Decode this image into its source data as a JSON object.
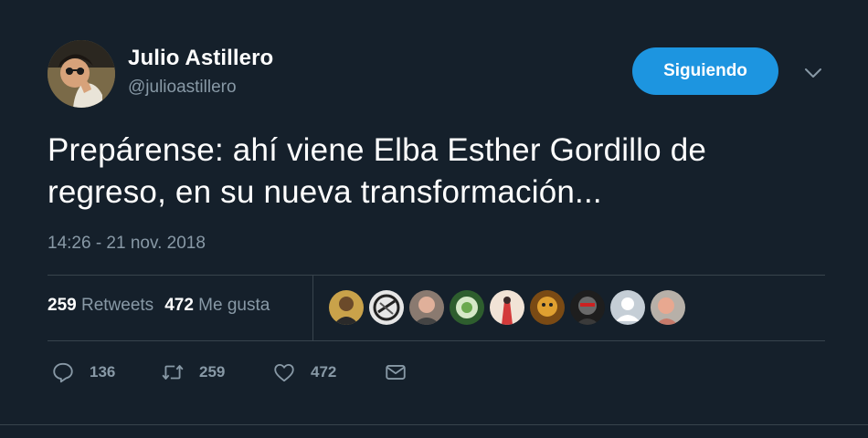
{
  "colors": {
    "background": "#15202b",
    "accent": "#1d95e0",
    "secondary_text": "#8899a6",
    "divider": "#38444d"
  },
  "author": {
    "display_name": "Julio Astillero",
    "handle": "@julioastillero",
    "follow_button_label": "Siguiendo"
  },
  "tweet": {
    "text_line1": "Prepárense: ahí viene Elba Esther Gordillo de",
    "text_line2": "regreso, en su nueva transformación...",
    "timestamp": "14:26 - 21 nov. 2018"
  },
  "stats": {
    "retweets_count": "259",
    "retweets_label": "Retweets",
    "likes_count": "472",
    "likes_label": "Me gusta"
  },
  "likers": [
    {
      "icon": "avatar-1",
      "color": "#c9a24a"
    },
    {
      "icon": "avatar-2",
      "color": "#d8d8d8"
    },
    {
      "icon": "avatar-3",
      "color": "#b08a78"
    },
    {
      "icon": "avatar-4",
      "color": "#3f7d3a"
    },
    {
      "icon": "avatar-5",
      "color": "#d94a4a"
    },
    {
      "icon": "avatar-6",
      "color": "#c88a2a"
    },
    {
      "icon": "avatar-7",
      "color": "#5a5a5a"
    },
    {
      "icon": "avatar-default",
      "color": "#c5ced6"
    },
    {
      "icon": "avatar-9",
      "color": "#d89a88"
    }
  ],
  "actions": {
    "reply_count": "136",
    "retweet_count": "259",
    "like_count": "472"
  },
  "icons": {
    "chevron": "chevron-down-icon",
    "reply": "reply-icon",
    "retweet": "retweet-icon",
    "like": "heart-icon",
    "message": "envelope-icon"
  }
}
